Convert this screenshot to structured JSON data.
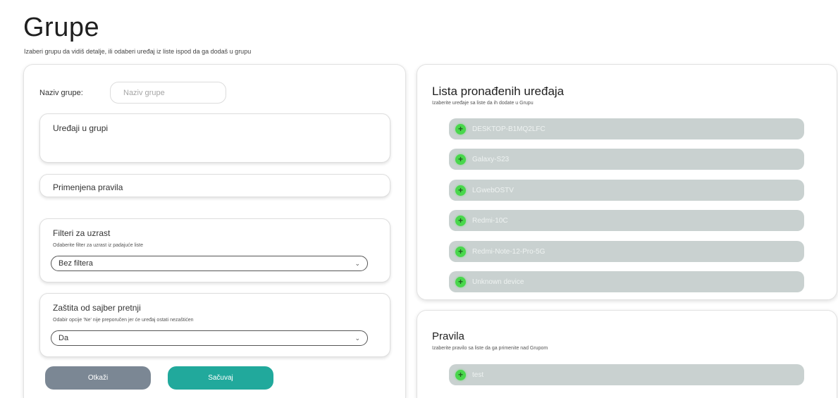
{
  "header": {
    "title": "Grupe",
    "subtitle": "Izaberi grupu da vidiš detalje, ili odaberi uređaj iz liste ispod da ga dodaš u grupu"
  },
  "group_form": {
    "name_label": "Naziv grupe:",
    "name_placeholder": "Naziv grupe",
    "name_value": "",
    "devices_section": {
      "title": "Uređaji u grupi"
    },
    "rules_section": {
      "title": "Primenjena pravila"
    },
    "filters_section": {
      "title": "Filteri za uzrast",
      "hint": "Odaberite filter za uzrast iz padajuće liste",
      "selected": "Bez filtera"
    },
    "protection_section": {
      "title": "Zaštita od sajber pretnji",
      "hint": "Odabir opcije 'Ne' nije preporučen jer će uređaj ostati nezaštićen",
      "selected": "Da"
    },
    "cancel_label": "Otkaži",
    "save_label": "Sačuvaj"
  },
  "device_list": {
    "title": "Lista pronađenih uređaja",
    "hint": "Izaberite uređaje sa liste da ih dodate u Grupu",
    "items": [
      {
        "label": "DESKTOP-B1MQ2LFC"
      },
      {
        "label": "Galaxy-S23"
      },
      {
        "label": "LGwebOSTV"
      },
      {
        "label": "Redmi-10C"
      },
      {
        "label": "Redmi-Note-12-Pro-5G"
      },
      {
        "label": "Unknown device"
      }
    ]
  },
  "rules_list": {
    "title": "Pravila",
    "hint": "Izaberite pravilo sa liste da ga primenite nad Grupom",
    "items": [
      {
        "label": "test"
      }
    ]
  },
  "colors": {
    "save_button": "#21a99c",
    "cancel_button": "#7b8794",
    "list_item_bg": "#c9d1d0",
    "plus_icon": "#49d74c"
  },
  "icons": {
    "add": "plus-circle-icon",
    "dropdown": "chevron-down-icon"
  }
}
